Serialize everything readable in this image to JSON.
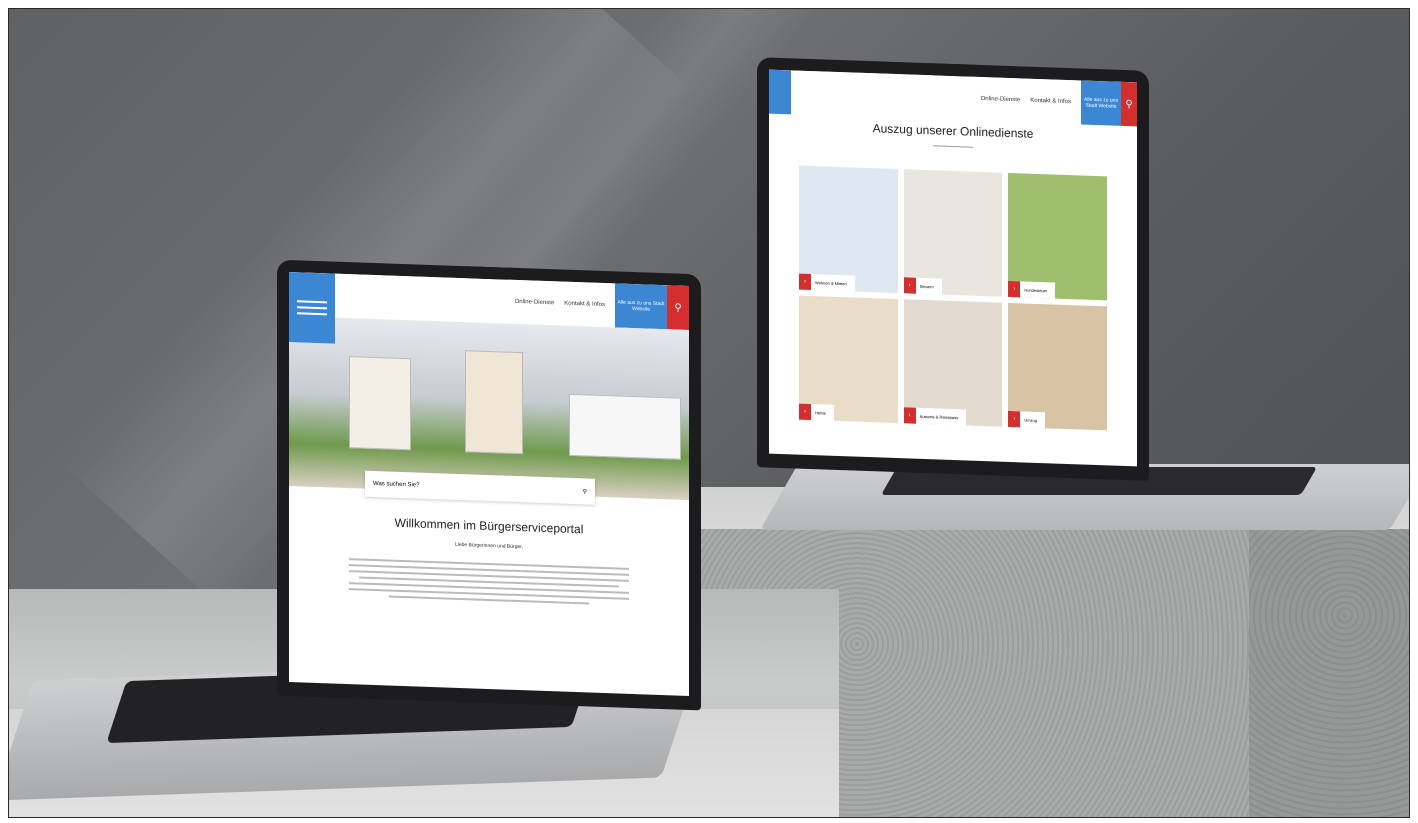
{
  "left_laptop": {
    "header": {
      "nav_items": [
        "Online-Dienste",
        "Kontakt & Infos"
      ],
      "cta_label": "Alle aus zu uns Stadt Website",
      "search_icon": "search-icon"
    },
    "hero": {
      "search_placeholder": "Was suchen Sie?"
    },
    "welcome": {
      "title": "Willkommen im Bürgerserviceportal",
      "subtitle": "Liebe Bürgerinnen und Bürger,"
    }
  },
  "right_laptop": {
    "header": {
      "nav_items": [
        "Online-Dienste",
        "Kontakt & Infos"
      ],
      "cta_label": "Alle aus zu uns Stadt Website",
      "search_icon": "search-icon"
    },
    "section_title": "Auszug unserer Onlinedienste",
    "tiles": [
      {
        "label": "Wohnen & Mieten",
        "color": "#dfe7f1"
      },
      {
        "label": "Steuern",
        "color": "#e8e6df"
      },
      {
        "label": "Hundesteuer",
        "color": "#9fbf6e"
      },
      {
        "label": "Heirat",
        "color": "#e9ddc8"
      },
      {
        "label": "Ausweis & Reisepass",
        "color": "#e2d9cf"
      },
      {
        "label": "Umzug",
        "color": "#d9c3a5"
      }
    ]
  },
  "colors": {
    "brand_blue": "#3c87d4",
    "brand_red": "#d32f2f"
  }
}
